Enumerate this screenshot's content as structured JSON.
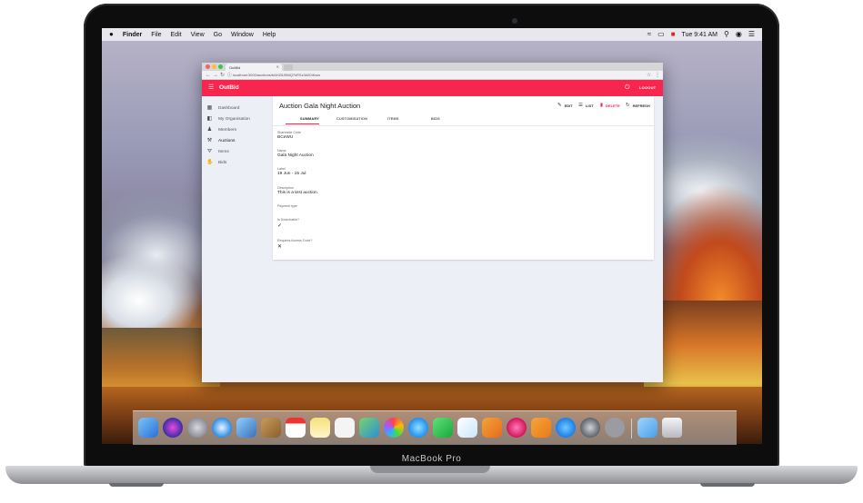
{
  "device": {
    "model": "MacBook Pro"
  },
  "menubar": {
    "apple": "",
    "items": [
      "Finder",
      "File",
      "Edit",
      "View",
      "Go",
      "Window",
      "Help"
    ],
    "clock": "Tue 9:41 AM"
  },
  "browser": {
    "tab_title": "OutBid",
    "address": "localhost:3000/auctions/bAHZ6JfMiQ7kRSz3AfCtKww",
    "new_tab_label": ""
  },
  "app": {
    "brand": "OutBid",
    "logout_label": "LOGOUT"
  },
  "sidebar": {
    "items": [
      {
        "label": "Dashboard",
        "icon": "dashboard-icon"
      },
      {
        "label": "My Organisation",
        "icon": "organisation-icon"
      },
      {
        "label": "Members",
        "icon": "members-icon"
      },
      {
        "label": "Auctions",
        "icon": "gavel-icon"
      },
      {
        "label": "Items",
        "icon": "cart-icon"
      },
      {
        "label": "Bids",
        "icon": "hand-icon"
      }
    ],
    "active_index": 3
  },
  "page": {
    "title": "Auction Gala Night Auction",
    "actions": {
      "edit": "EDIT",
      "list": "LIST",
      "delete": "DELETE",
      "refresh": "REFRESH"
    },
    "tabs": [
      "SUMMARY",
      "CUSTOMISATION",
      "ITEMS",
      "BIDS"
    ],
    "active_tab": 0
  },
  "fields": {
    "shareable_code_label": "Shareable Code",
    "shareable_code_value": "BCeWU",
    "name_label": "Name",
    "name_value": "Gala Night Auction",
    "label_label": "Label",
    "label_value": "19 Jun - 15 Jul",
    "description_label": "Description",
    "description_value": "This is a test auction.",
    "payment_type_label": "Payment type",
    "payment_type_value": "",
    "is_searchable_label": "Is Searchable?",
    "is_searchable_value": "✓",
    "requires_access_code_label": "Requires Access Code?",
    "requires_access_code_value": "✕"
  },
  "colors": {
    "brand": "#f6264f",
    "background": "#eceff6"
  }
}
